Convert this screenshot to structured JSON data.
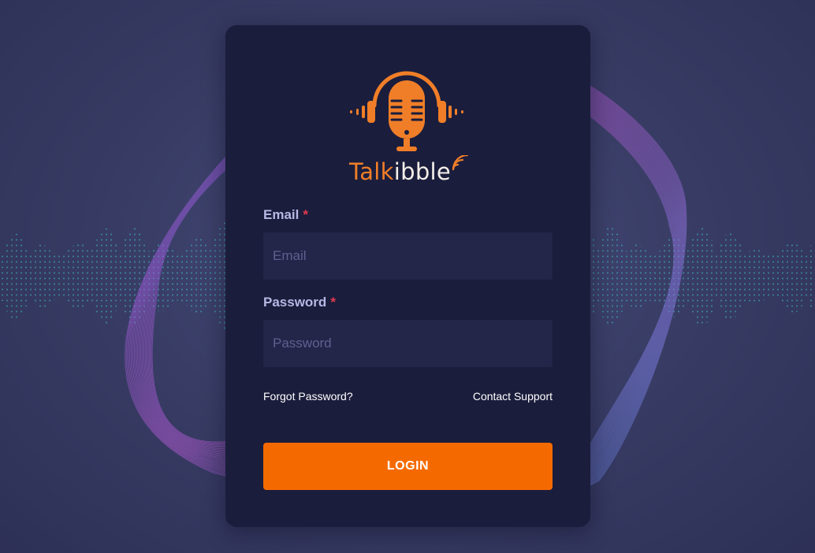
{
  "brand": {
    "name_part1": "Talk",
    "name_part2": "ibble"
  },
  "form": {
    "email_label": "Email",
    "email_required": "*",
    "email_placeholder": "Email",
    "email_value": "",
    "password_label": "Password",
    "password_required": "*",
    "password_placeholder": "Password",
    "password_value": ""
  },
  "links": {
    "forgot_password": "Forgot Password?",
    "contact_support": "Contact Support"
  },
  "login_button": "LOGIN",
  "icons": {
    "logo": "microphone-headphones-logo-icon",
    "brand_waves": "signal-waves-icon"
  },
  "colors": {
    "background": "#373b63",
    "card": "#1b1d3c",
    "input": "#232549",
    "accent_orange": "#f56a00",
    "label": "#b7b8e4",
    "required": "#e23a4e"
  }
}
